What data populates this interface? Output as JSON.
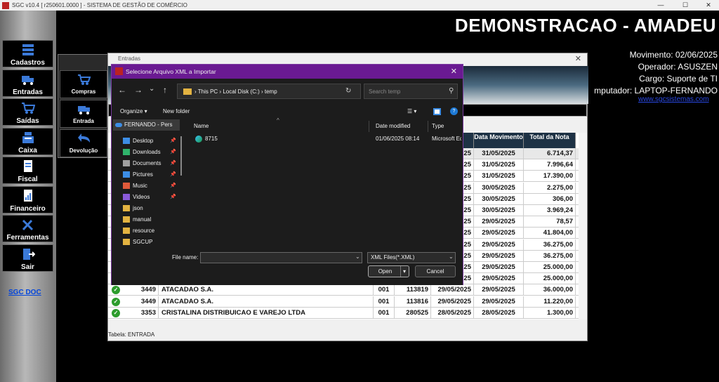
{
  "window": {
    "title": "SGC v10.4 [ r250601.0000 ] - SISTEMA DE GESTÃO DE COMÉRCIO",
    "minimize": "—",
    "maximize": "☐",
    "close": "✕"
  },
  "sidebar": {
    "items": [
      {
        "label": "Cadastros",
        "icon": "database-icon"
      },
      {
        "label": "Entradas",
        "icon": "truck-icon"
      },
      {
        "label": "Saídas",
        "icon": "cart-icon"
      },
      {
        "label": "Caixa",
        "icon": "cash-register-icon"
      },
      {
        "label": "Fiscal",
        "icon": "document-icon"
      },
      {
        "label": "Financeiro",
        "icon": "report-icon"
      },
      {
        "label": "Ferramentas",
        "icon": "tools-icon"
      },
      {
        "label": "Sair",
        "icon": "exit-icon"
      }
    ],
    "doc_link": "SGC DOC"
  },
  "header": {
    "company": "DEMONSTRACAO - AMADEU",
    "movimento": "Movimento: 02/06/2025",
    "operador": "Operador: ASUSZEN",
    "cargo": "Cargo: Suporte de TI",
    "computador": "mputador: LAPTOP-FERNANDO",
    "site": "www.sgcsistemas.com"
  },
  "subpanel": {
    "items": [
      {
        "label": "Compras"
      },
      {
        "label": "Entrada"
      },
      {
        "label": "Devolução"
      }
    ]
  },
  "entradas": {
    "title": "Entradas",
    "close": "✕",
    "status": "Tabela: ENTRADA",
    "columns": {
      "emissao_partial": "o",
      "data_movimento": "Data Movimento",
      "total_nota": "Total da Nota"
    },
    "rows": [
      {
        "code": "",
        "name": "",
        "serie": "",
        "nota": "",
        "emissao": "25",
        "movimento": "31/05/2025",
        "total": "6.714,37"
      },
      {
        "code": "",
        "name": "",
        "serie": "",
        "nota": "",
        "emissao": "25",
        "movimento": "31/05/2025",
        "total": "7.996,64"
      },
      {
        "code": "",
        "name": "",
        "serie": "",
        "nota": "",
        "emissao": "25",
        "movimento": "31/05/2025",
        "total": "17.390,00"
      },
      {
        "code": "",
        "name": "",
        "serie": "",
        "nota": "",
        "emissao": "25",
        "movimento": "30/05/2025",
        "total": "2.275,00"
      },
      {
        "code": "",
        "name": "",
        "serie": "",
        "nota": "",
        "emissao": "25",
        "movimento": "30/05/2025",
        "total": "306,00"
      },
      {
        "code": "",
        "name": "",
        "serie": "",
        "nota": "",
        "emissao": "25",
        "movimento": "30/05/2025",
        "total": "3.969,24"
      },
      {
        "code": "",
        "name": "",
        "serie": "",
        "nota": "",
        "emissao": "25",
        "movimento": "29/05/2025",
        "total": "78,57"
      },
      {
        "code": "",
        "name": "",
        "serie": "",
        "nota": "",
        "emissao": "25",
        "movimento": "29/05/2025",
        "total": "41.804,00"
      },
      {
        "code": "",
        "name": "",
        "serie": "",
        "nota": "",
        "emissao": "25",
        "movimento": "29/05/2025",
        "total": "36.275,00"
      },
      {
        "code": "",
        "name": "",
        "serie": "",
        "nota": "",
        "emissao": "25",
        "movimento": "29/05/2025",
        "total": "36.275,00"
      },
      {
        "code": "",
        "name": "",
        "serie": "",
        "nota": "",
        "emissao": "25",
        "movimento": "29/05/2025",
        "total": "25.000,00"
      },
      {
        "code": "",
        "name": "",
        "serie": "",
        "nota": "",
        "emissao": "25",
        "movimento": "29/05/2025",
        "total": "25.000,00"
      },
      {
        "code": "3449",
        "name": "ATACADAO S.A.",
        "serie": "001",
        "nota": "113819",
        "emissao": "29/05/2025",
        "movimento": "29/05/2025",
        "total": "36.000,00"
      },
      {
        "code": "3449",
        "name": "ATACADAO S.A.",
        "serie": "001",
        "nota": "113816",
        "emissao": "29/05/2025",
        "movimento": "29/05/2025",
        "total": "11.220,00"
      },
      {
        "code": "3353",
        "name": "CRISTALINA DISTRIBUICAO E VAREJO LTDA",
        "serie": "001",
        "nota": "280525",
        "emissao": "28/05/2025",
        "movimento": "28/05/2025",
        "total": "1.300,00"
      }
    ]
  },
  "dialog": {
    "title": "Selecione Arquivo XML a Importar",
    "close": "✕",
    "nav": {
      "back": "←",
      "forward": "→",
      "recent": "⌄",
      "up": "↑"
    },
    "path": {
      "pc": "This PC",
      "disk": "Local Disk (C:)",
      "folder": "temp"
    },
    "refresh": "↻",
    "search_placeholder": "Search temp",
    "organize": "Organize ▾",
    "new_folder": "New folder",
    "view_ic": "☰ ▾",
    "help": "?",
    "nav_pane": {
      "user": "FERNANDO - Pers",
      "items": [
        {
          "label": "Desktop",
          "color": "#3d8ee6"
        },
        {
          "label": "Downloads",
          "color": "#2fb36b"
        },
        {
          "label": "Documents",
          "color": "#a0a0a0"
        },
        {
          "label": "Pictures",
          "color": "#3d8ee6"
        },
        {
          "label": "Music",
          "color": "#e05a3a"
        },
        {
          "label": "Videos",
          "color": "#8a5ad9"
        },
        {
          "label": "json",
          "color": "#e3b341"
        },
        {
          "label": "manual",
          "color": "#e3b341"
        },
        {
          "label": "resource",
          "color": "#e3b341"
        },
        {
          "label": "SGCUP",
          "color": "#e3b341"
        }
      ],
      "pin": "📌"
    },
    "columns": {
      "name": "Name",
      "date": "Date modified",
      "type": "Type"
    },
    "files": [
      {
        "name": "8715",
        "date": "01/06/2025 08:14",
        "type": "Microsoft Ed"
      }
    ],
    "filename_label": "File name:",
    "filename_value": "",
    "filter": "XML Files(*.XML)",
    "open": "Open",
    "cancel": "Cancel"
  }
}
